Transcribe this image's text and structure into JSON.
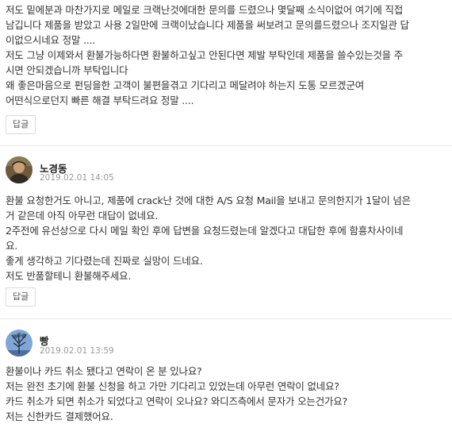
{
  "comments": [
    {
      "lines": [
        "저도 밑에분과 마찬가지로 메일로 크랙난것에대한 문의를 드렸으나 몇달째 소식이없어 여기에 직접",
        "남깁니다 제품을 받았고 사용 2일만에 크랙이났습니다 제품을 써보려고 문의를드렸으나 조지일관 답",
        "이없으시네요 정말 ....",
        "저도 그냥 이제와서 환불가능하다면 환불하고싶고 안된다면 제발 부탁인데 제품을 쓸수있는것을 주",
        "시면 안되겠습니까 부탁입니다",
        "왜 좋은마음으로 펀딩을한 고객이 불편을겪고 기다리고 메달려야 하는지 도통 모르겠군여",
        "어떤식으로던지 빠른 해결 부탁드려요 정말 ...."
      ],
      "reply_label": "답글"
    },
    {
      "author": "노경동",
      "date": "2019.02.01 14:05",
      "avatar_icon": "person-photo",
      "lines": [
        "환불 요청한거도 아니고, 제품에 crack난 것에 대한 A/S 요청 Mail을 보내고 문의한지가 1달이 넘은",
        "거 같은데 아직 아무런 대답이 없네요.",
        "2주전에 유선상으로 다시 메일 확인 후에 답변을 요청드렸는데 알겠다고 대답한 후에 함흥차사이네",
        "요.",
        "좋게 생각하고 기다렸는데 진짜로 실망이 드네요.",
        "저도 반품할테니 환불해주세요."
      ],
      "reply_label": "답글"
    },
    {
      "author": "빵",
      "date": "2019.02.01 13:59",
      "avatar_icon": "tree-photo",
      "lines": [
        "환불이나 카드 취소 됐다고 연락이 온 분 있나요?",
        "저는 완전 초기에 환불 신청을 하고 가만 기다리고 있었는데 아무런 연락이 없네요?",
        "카드 취소가 되면 취소가 되었다고 연락이 오나요? 와디즈측에서 문자가 오는건가요?",
        "저는 신한카드 결제했어요."
      ]
    }
  ]
}
